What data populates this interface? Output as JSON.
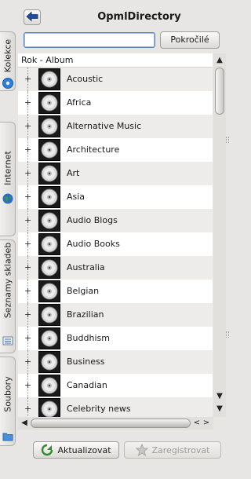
{
  "dock_tabs": [
    {
      "label": "Kolekce",
      "icon": "collection-disc-icon"
    },
    {
      "label": "Internet",
      "icon": "globe-icon"
    },
    {
      "label": "Seznamy skladeb",
      "icon": "playlist-icon"
    },
    {
      "label": "Soubory",
      "icon": "folder-icon"
    }
  ],
  "header": {
    "title": "OpmlDirectory",
    "back_icon": "arrow-left-icon"
  },
  "search": {
    "value": "",
    "placeholder": ""
  },
  "advanced_button": {
    "label": "Pokročilé"
  },
  "list": {
    "column_header": "Rok - Album",
    "items": [
      {
        "label": "Acoustic"
      },
      {
        "label": "Africa"
      },
      {
        "label": "Alternative Music"
      },
      {
        "label": "Architecture"
      },
      {
        "label": "Art"
      },
      {
        "label": "Asia"
      },
      {
        "label": "Audio Blogs"
      },
      {
        "label": "Audio Books"
      },
      {
        "label": "Australia"
      },
      {
        "label": "Belgian"
      },
      {
        "label": "Brazilian"
      },
      {
        "label": "Buddhism"
      },
      {
        "label": "Business"
      },
      {
        "label": "Canadian"
      },
      {
        "label": "Celebrity news"
      }
    ],
    "expander_glyph": "+",
    "item_icon": "cd-icon"
  },
  "scrollbars": {
    "up": "▲",
    "down": "▼",
    "left": "◀",
    "right": "▶",
    "left_small": "<",
    "right_small": ">"
  },
  "footer": {
    "update_button": "Aktualizovat",
    "register_button": "Zaregistrovat"
  },
  "colors": {
    "accent_blue": "#5a81b5",
    "row_alt": "#edecea",
    "window_bg": "#e8e6e4"
  }
}
